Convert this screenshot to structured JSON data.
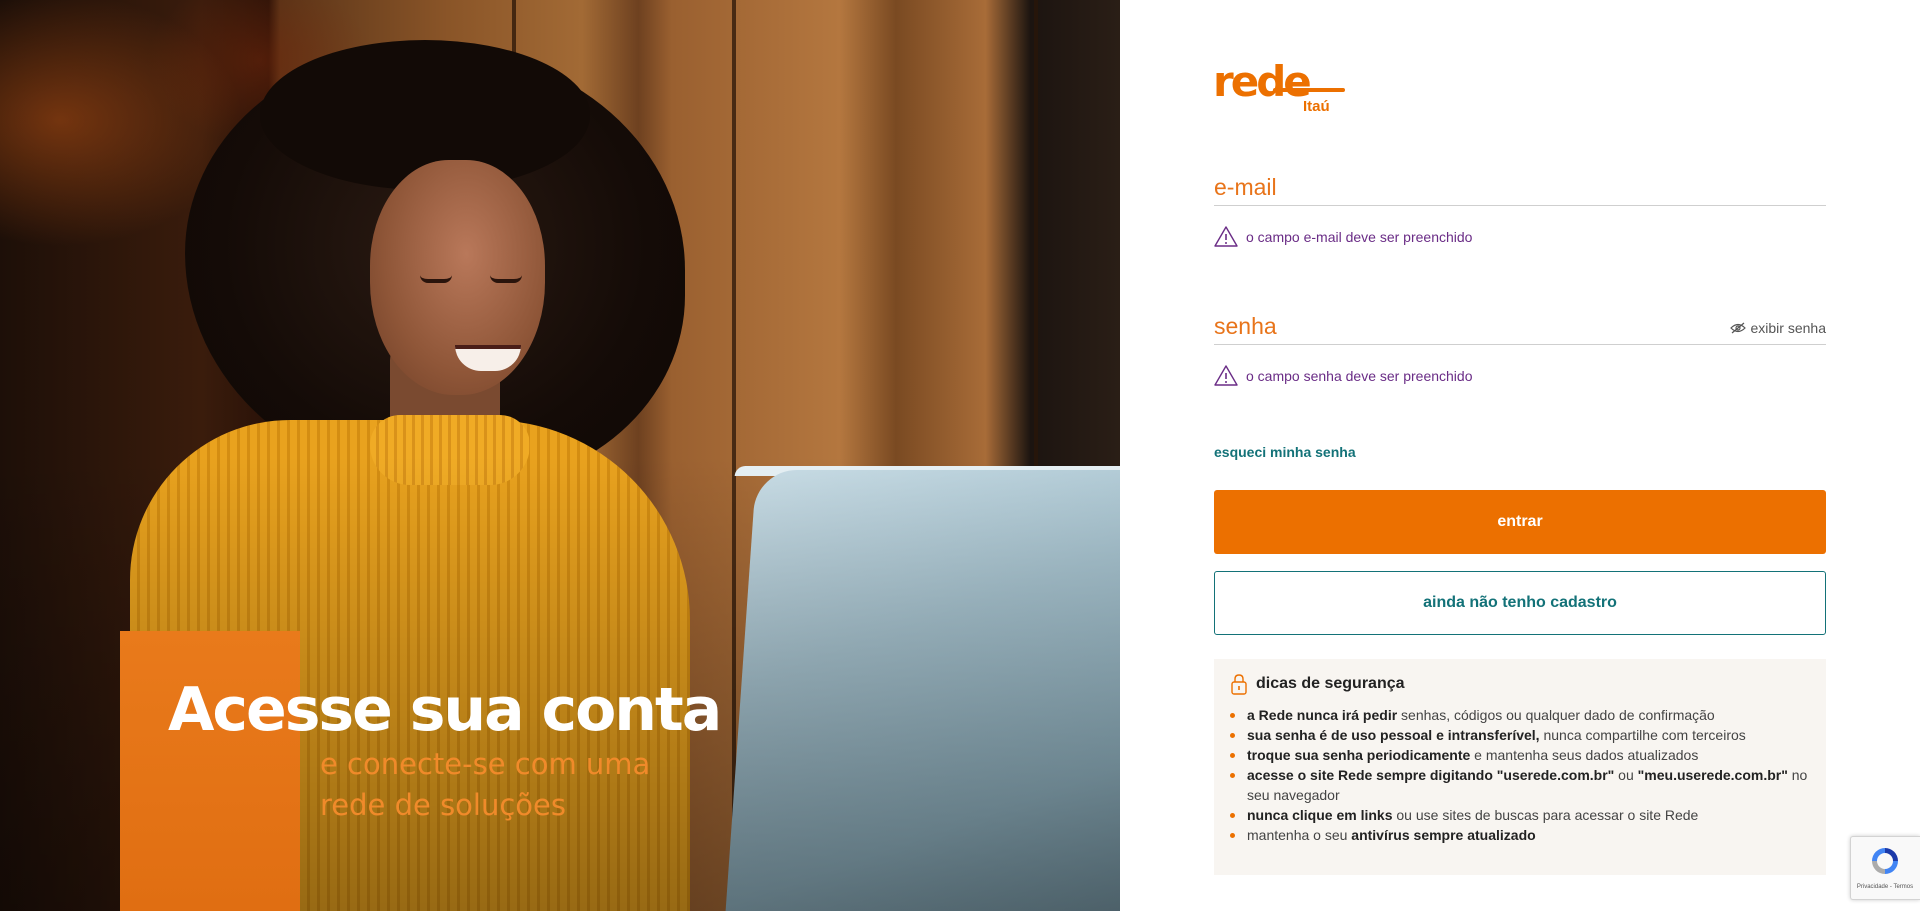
{
  "hero": {
    "title": "Acesse sua conta",
    "subtitle_line1": "e conecte-se com uma",
    "subtitle_line2": "rede de soluções"
  },
  "brand": {
    "logo_word": "rede",
    "logo_sub": "Itaú",
    "accent_color": "#ec7000",
    "secondary_color": "#137278",
    "error_color": "#6a2c86"
  },
  "form": {
    "email": {
      "label": "e-mail",
      "value": "",
      "error": "o campo e-mail deve ser preenchido"
    },
    "password": {
      "label": "senha",
      "value": "",
      "toggle_label": "exibir senha",
      "error": "o campo senha deve ser preenchido"
    },
    "forgot_label": "esqueci minha senha",
    "submit_label": "entrar",
    "register_label": "ainda não tenho cadastro"
  },
  "security_tips": {
    "title": "dicas de segurança",
    "items": [
      {
        "bold": "a Rede nunca irá pedir",
        "rest": " senhas, códigos ou qualquer dado de confirmação"
      },
      {
        "bold": "sua senha é de uso pessoal e intransferível,",
        "rest": " nunca compartilhe com terceiros"
      },
      {
        "bold": "troque sua senha periodicamente",
        "rest": " e mantenha seus dados atualizados"
      },
      {
        "bold": "acesse o site Rede sempre digitando \"userede.com.br\"",
        "rest": " ou ",
        "bold2": "\"meu.userede.com.br\"",
        "rest2": " no seu navegador"
      },
      {
        "bold": "nunca clique em links",
        "rest": " ou use sites de buscas para acessar o site Rede"
      },
      {
        "pre": "mantenha o seu ",
        "bold": "antivírus sempre atualizado",
        "rest": ""
      }
    ]
  },
  "recaptcha": {
    "text": "Privacidade - Termos"
  }
}
